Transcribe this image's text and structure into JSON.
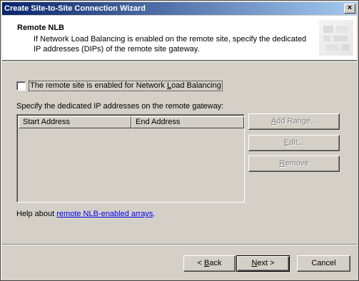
{
  "window": {
    "title": "Create Site-to-Site Connection Wizard",
    "close_glyph": "×"
  },
  "header": {
    "title": "Remote NLB",
    "description": "If Network Load Balancing is enabled on the remote site, specify the dedicated IP addresses (DIPs) of the remote site gateway."
  },
  "nlb_checkbox": {
    "checked": false,
    "label_before": "The remote site is enabled for Network ",
    "label_mnemonic": "L",
    "label_after": "oad Balancing"
  },
  "address_list": {
    "label": "Specify the dedicated IP addresses on the remote gateway:",
    "columns": [
      "Start Address",
      "End Address"
    ],
    "rows": []
  },
  "side_buttons": {
    "add_range": {
      "mnemonic": "A",
      "rest": "dd Range...",
      "enabled": false
    },
    "edit": {
      "mnemonic": "E",
      "rest": "dit...",
      "enabled": false
    },
    "remove": {
      "mnemonic": "R",
      "rest": "emove",
      "enabled": false
    }
  },
  "help": {
    "prefix": "Help about ",
    "link_text": "remote NLB-enabled arrays",
    "suffix": "."
  },
  "footer": {
    "back": {
      "prefix": "< ",
      "mnemonic": "B",
      "rest": "ack"
    },
    "next": {
      "mnemonic": "N",
      "rest": "ext >"
    },
    "cancel": "Cancel"
  }
}
